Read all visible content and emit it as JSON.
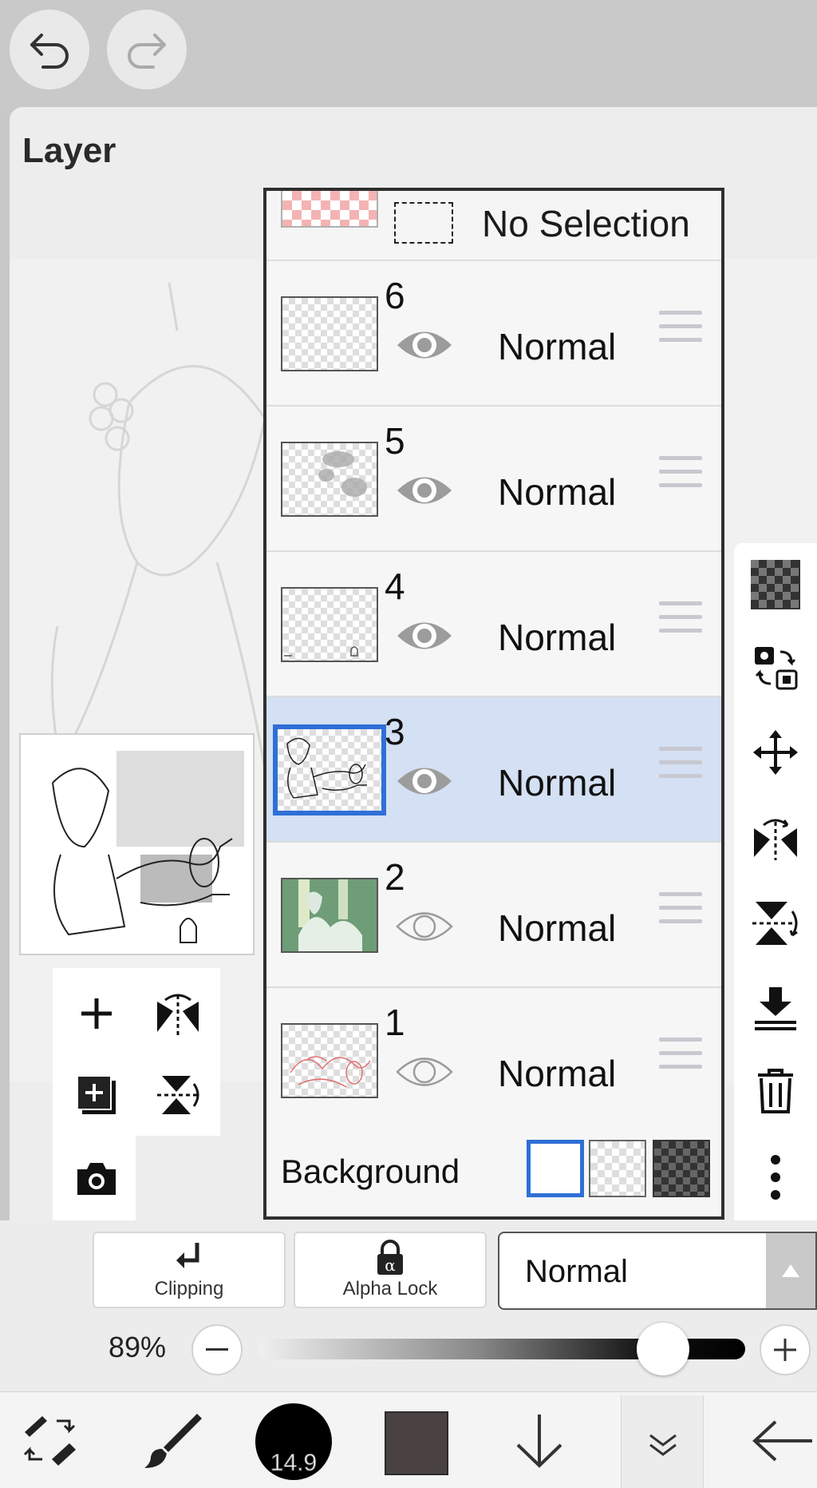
{
  "panel": {
    "title": "Layer"
  },
  "selection_row": {
    "label": "No Selection"
  },
  "layers": [
    {
      "name": "6",
      "mode": "Normal",
      "visible": true,
      "selected": false
    },
    {
      "name": "5",
      "mode": "Normal",
      "visible": true,
      "selected": false
    },
    {
      "name": "4",
      "mode": "Normal",
      "visible": true,
      "selected": false
    },
    {
      "name": "3",
      "mode": "Normal",
      "visible": true,
      "selected": true
    },
    {
      "name": "2",
      "mode": "Normal",
      "visible": false,
      "selected": false
    },
    {
      "name": "1",
      "mode": "Normal",
      "visible": false,
      "selected": false
    }
  ],
  "background": {
    "label": "Background",
    "selected_option": "white"
  },
  "options": {
    "clipping_label": "Clipping",
    "alpha_lock_label": "Alpha Lock",
    "blend_mode": "Normal"
  },
  "opacity": {
    "label": "89%",
    "value": 0.89
  },
  "toolbar": {
    "brush_size": "14.9",
    "color": "#4a4242"
  },
  "colors": {
    "selection_blue": "#2f6fd6",
    "selected_row": "#d4e0f3"
  }
}
